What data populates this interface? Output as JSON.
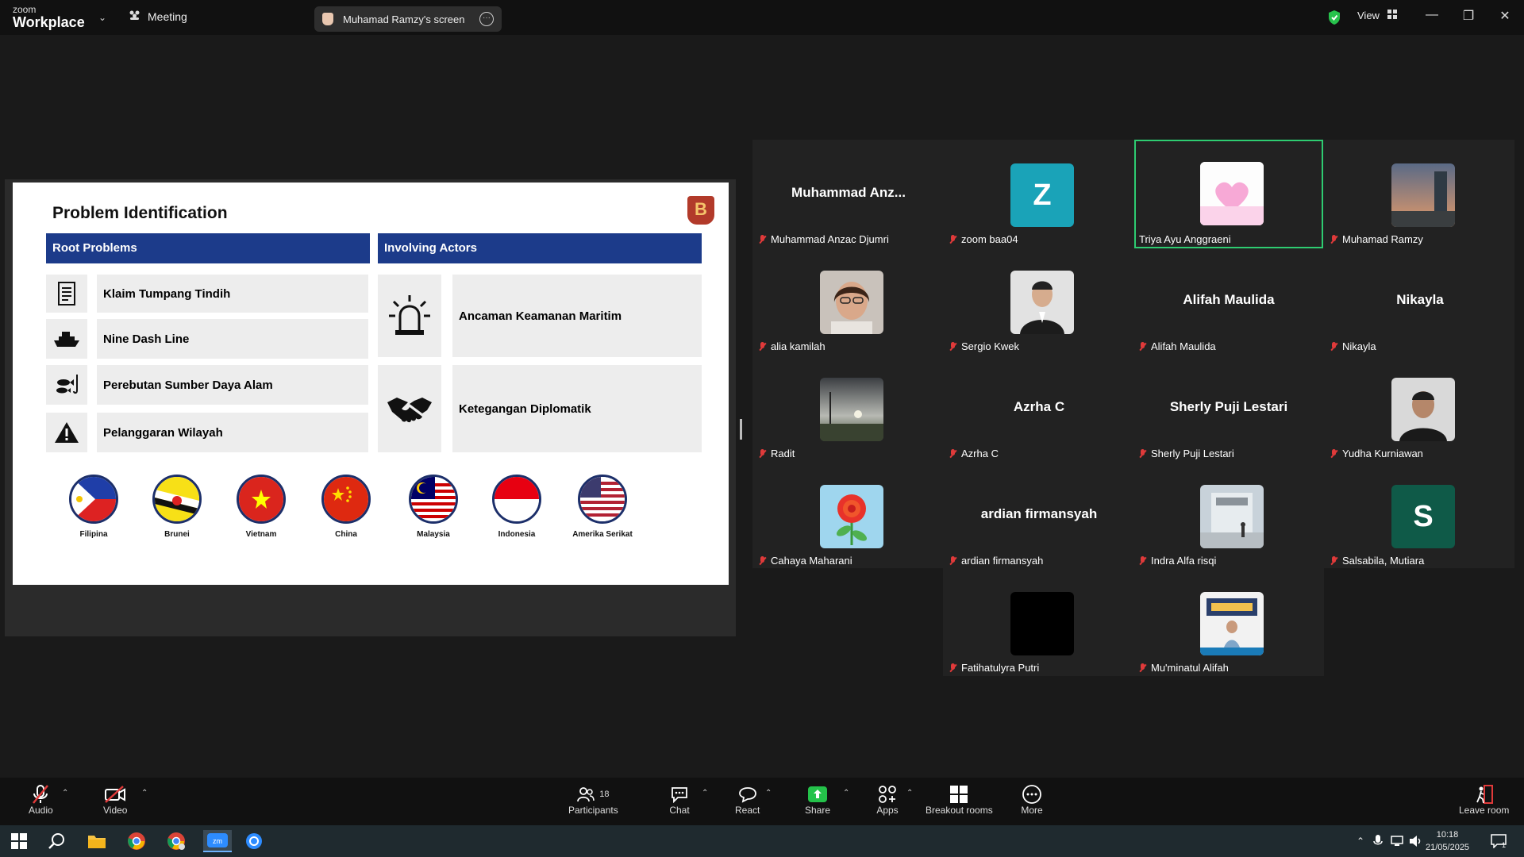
{
  "app": {
    "logo_line1": "zoom",
    "logo_line2": "Workplace",
    "meeting_label": "Meeting",
    "share_title": "Muhamad Ramzy's screen",
    "view_label": "View"
  },
  "slide": {
    "title": "Problem Identification",
    "badge": "B",
    "root_header": "Root Problems",
    "actors_header": "Involving Actors",
    "root_problems": [
      "Klaim Tumpang Tindih",
      "Nine Dash Line",
      "Perebutan Sumber Daya Alam",
      "Pelanggaran Wilayah"
    ],
    "actors": [
      "Ancaman Keamanan Maritim",
      "Ketegangan Diplomatik"
    ],
    "countries": [
      "Filipina",
      "Brunei",
      "Vietnam",
      "China",
      "Malaysia",
      "Indonesia",
      "Amerika Serikat"
    ]
  },
  "participants": [
    {
      "label": "Muhammad Anzac Djumri",
      "big": "Muhammad  Anz..."
    },
    {
      "label": "zoom baa04",
      "letter": "Z",
      "color": "#1aa3b8"
    },
    {
      "label": "Triya Ayu Anggraeni",
      "active": true
    },
    {
      "label": "Muhamad Ramzy"
    },
    {
      "label": "alia kamilah"
    },
    {
      "label": "Sergio Kwek"
    },
    {
      "label": "Alifah Maulida",
      "big": "Alifah Maulida"
    },
    {
      "label": "Nikayla",
      "big": "Nikayla"
    },
    {
      "label": "Radit"
    },
    {
      "label": "Azrha C",
      "big": "Azrha C"
    },
    {
      "label": "Sherly Puji Lestari",
      "big": "Sherly Puji Lestari"
    },
    {
      "label": "Yudha Kurniawan"
    },
    {
      "label": "Cahaya Maharani"
    },
    {
      "label": "ardian firmansyah",
      "big": "ardian firmansyah"
    },
    {
      "label": "Indra Alfa risqi"
    },
    {
      "label": "Salsabila, Mutiara",
      "letter": "S",
      "color": "#0f5a48"
    },
    {
      "label": "Fatihatulyra Putri"
    },
    {
      "label": "Mu'minatul Alifah"
    }
  ],
  "toolbar": {
    "audio": "Audio",
    "video": "Video",
    "participants": "Participants",
    "participants_count": "18",
    "chat": "Chat",
    "react": "React",
    "share": "Share",
    "apps": "Apps",
    "breakout": "Breakout rooms",
    "more": "More",
    "leave": "Leave room"
  },
  "taskbar": {
    "time": "10:18",
    "date": "21/05/2025",
    "notif_count": "1"
  }
}
